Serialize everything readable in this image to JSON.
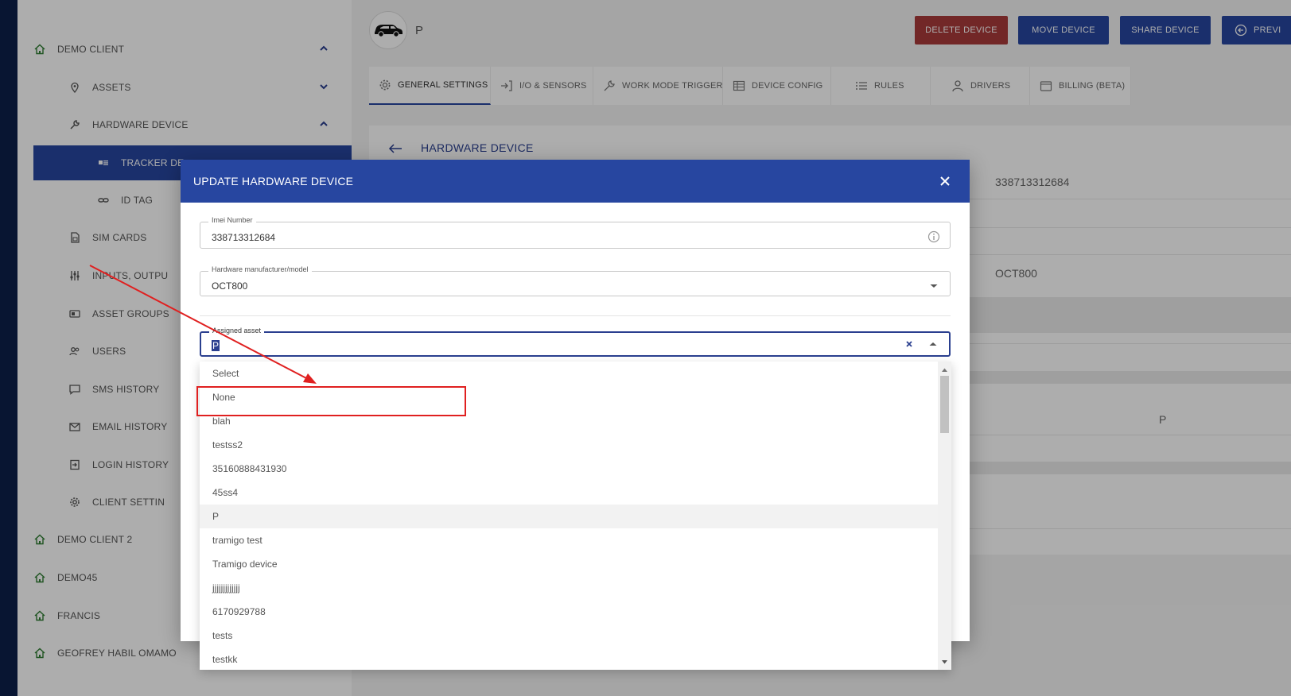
{
  "sidebar": {
    "items": [
      {
        "label": "DEMO CLIENT",
        "icon": "home-icon",
        "level": 0,
        "chevron": "up"
      },
      {
        "label": "ASSETS",
        "icon": "pin-icon",
        "level": 1,
        "chevron": "down"
      },
      {
        "label": "HARDWARE DEVICE",
        "icon": "wrench-icon",
        "level": 1,
        "chevron": "up"
      },
      {
        "label": "TRACKER DE",
        "icon": "card-icon",
        "level": 2,
        "active": true
      },
      {
        "label": "ID TAG",
        "icon": "link-icon",
        "level": 2
      },
      {
        "label": "SIM CARDS",
        "icon": "sim-icon",
        "level": 1
      },
      {
        "label": "INPUTS, OUTPU",
        "icon": "sliders-icon",
        "level": 1
      },
      {
        "label": "ASSET GROUPS",
        "icon": "group-icon",
        "level": 1
      },
      {
        "label": "USERS",
        "icon": "users-icon",
        "level": 1
      },
      {
        "label": "SMS HISTORY",
        "icon": "message-icon",
        "level": 1
      },
      {
        "label": "EMAIL HISTORY",
        "icon": "mail-icon",
        "level": 1
      },
      {
        "label": "LOGIN HISTORY",
        "icon": "login-icon",
        "level": 1
      },
      {
        "label": "CLIENT SETTIN",
        "icon": "gear-icon",
        "level": 1
      },
      {
        "label": "DEMO CLIENT 2",
        "icon": "home-icon",
        "level": 0
      },
      {
        "label": "DEMO45",
        "icon": "home-icon",
        "level": 0
      },
      {
        "label": "FRANCIS",
        "icon": "home-icon",
        "level": 0
      },
      {
        "label": "GEOFREY HABIL OMAMO",
        "icon": "home-icon",
        "level": 0,
        "chevron": "down"
      }
    ]
  },
  "header": {
    "device_name": "P",
    "buttons": {
      "delete": "DELETE DEVICE",
      "move": "MOVE DEVICE",
      "share": "SHARE DEVICE",
      "previous": "PREVI"
    }
  },
  "tabs": [
    {
      "label": "GENERAL SETTINGS",
      "icon": "gear-icon",
      "active": true
    },
    {
      "label": "I/O & SENSORS",
      "icon": "input-icon"
    },
    {
      "label": "WORK MODE TRIGGER",
      "icon": "wrench-icon"
    },
    {
      "label": "DEVICE CONFIG",
      "icon": "table-icon"
    },
    {
      "label": "RULES",
      "icon": "list-icon"
    },
    {
      "label": "DRIVERS",
      "icon": "person-icon"
    },
    {
      "label": "BILLING (BETA)",
      "icon": "wallet-icon"
    }
  ],
  "card": {
    "title": "HARDWARE DEVICE",
    "imei_value": "338713312684",
    "model_value": "OCT800",
    "asset_value": "P"
  },
  "modal": {
    "title": "UPDATE HARDWARE DEVICE",
    "imei": {
      "label": "Imei Number",
      "value": "338713312684"
    },
    "model": {
      "label": "Hardware manufacturer/model",
      "value": "OCT800"
    },
    "asset": {
      "label": "Assigned asset",
      "value": "P"
    }
  },
  "dropdown": {
    "options": [
      "Select",
      "None",
      "blah",
      "testss2",
      "35160888431930",
      "45ss4",
      "P",
      "tramigo test",
      "Tramigo device",
      "jjjjjjjjjjjjj",
      "6170929788",
      "tests",
      "testkk"
    ],
    "highlighted": "P"
  },
  "colors": {
    "primary": "#2746a0",
    "danger": "#a83a3a",
    "annotation": "#e02020",
    "home_icon": "#2e7d32"
  }
}
